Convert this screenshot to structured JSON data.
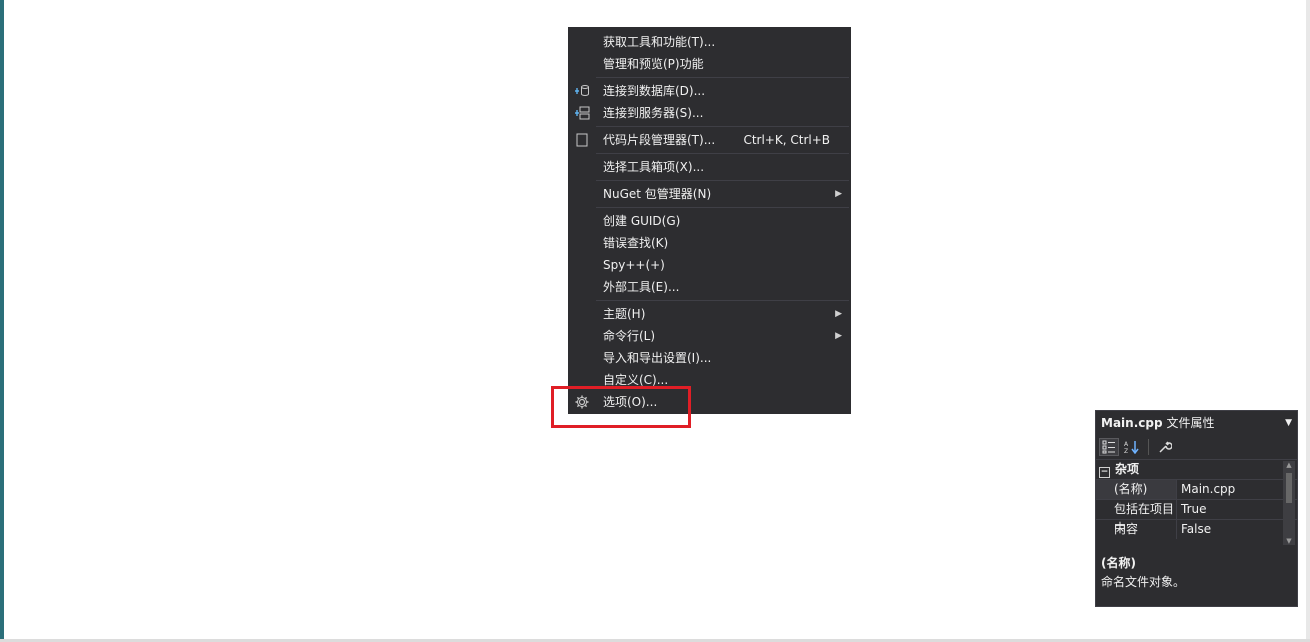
{
  "menu": {
    "items": [
      {
        "label": "获取工具和功能(T)...",
        "shortcut": "",
        "icon": "",
        "submenu": false,
        "sep_after": false
      },
      {
        "label": "管理和预览(P)功能",
        "shortcut": "",
        "icon": "",
        "submenu": false,
        "sep_after": true
      },
      {
        "label": "连接到数据库(D)...",
        "shortcut": "",
        "icon": "database-connect-icon",
        "submenu": false,
        "sep_after": false
      },
      {
        "label": "连接到服务器(S)...",
        "shortcut": "",
        "icon": "server-connect-icon",
        "submenu": false,
        "sep_after": true
      },
      {
        "label": "代码片段管理器(T)...",
        "shortcut": "Ctrl+K, Ctrl+B",
        "icon": "snippet-icon",
        "submenu": false,
        "sep_after": true
      },
      {
        "label": "选择工具箱项(X)...",
        "shortcut": "",
        "icon": "",
        "submenu": false,
        "sep_after": true
      },
      {
        "label": "NuGet 包管理器(N)",
        "shortcut": "",
        "icon": "",
        "submenu": true,
        "sep_after": true
      },
      {
        "label": "创建 GUID(G)",
        "shortcut": "",
        "icon": "",
        "submenu": false,
        "sep_after": false
      },
      {
        "label": "错误查找(K)",
        "shortcut": "",
        "icon": "",
        "submenu": false,
        "sep_after": false
      },
      {
        "label": "Spy++(+)",
        "shortcut": "",
        "icon": "",
        "submenu": false,
        "sep_after": false
      },
      {
        "label": "外部工具(E)...",
        "shortcut": "",
        "icon": "",
        "submenu": false,
        "sep_after": true
      },
      {
        "label": "主题(H)",
        "shortcut": "",
        "icon": "",
        "submenu": true,
        "sep_after": false
      },
      {
        "label": "命令行(L)",
        "shortcut": "",
        "icon": "",
        "submenu": true,
        "sep_after": false
      },
      {
        "label": "导入和导出设置(I)...",
        "shortcut": "",
        "icon": "",
        "submenu": false,
        "sep_after": false
      },
      {
        "label": "自定义(C)...",
        "shortcut": "",
        "icon": "",
        "submenu": false,
        "sep_after": false
      },
      {
        "label": "选项(O)...",
        "shortcut": "",
        "icon": "gear-icon",
        "submenu": false,
        "sep_after": false
      }
    ],
    "highlight_color": "#e01e26"
  },
  "properties": {
    "file_name": "Main.cpp",
    "title_suffix": "文件属性",
    "category": "杂项",
    "rows": [
      {
        "key": "(名称)",
        "value": "Main.cpp"
      },
      {
        "key": "包括在项目中",
        "value": "True"
      },
      {
        "key": "内容",
        "value": "False"
      }
    ],
    "desc_title": "(名称)",
    "desc_text": "命名文件对象。"
  }
}
